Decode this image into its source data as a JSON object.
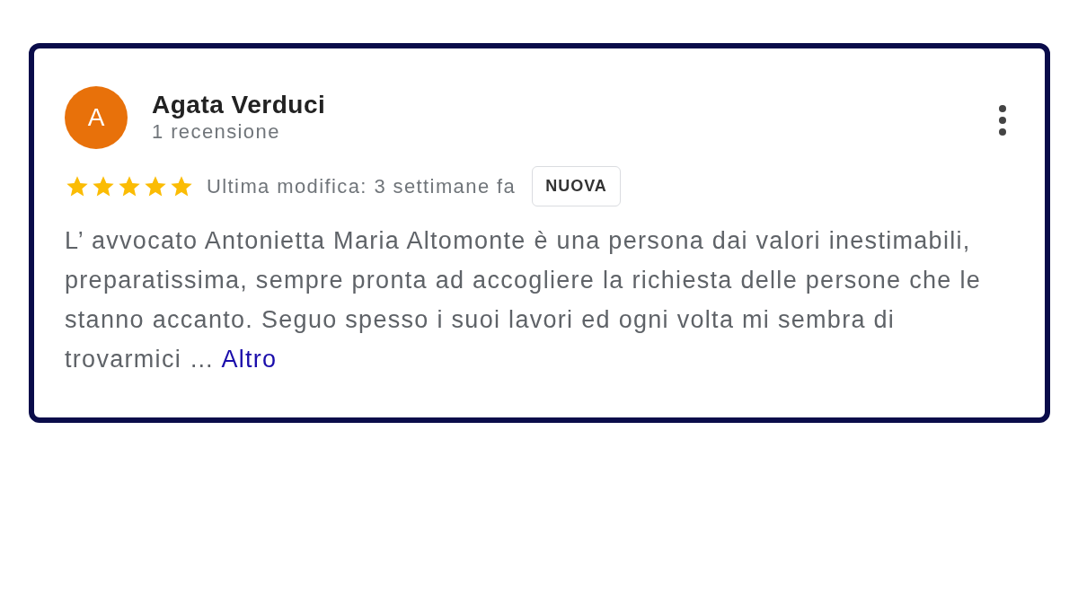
{
  "review": {
    "avatar_initial": "A",
    "name": "Agata Verduci",
    "review_count": "1 recensione",
    "stars": 5,
    "edited": "Ultima modifica: 3 settimane fa",
    "badge": "NUOVA",
    "text": "L’ avvocato Antonietta Maria Altomonte è una persona dai valori inestimabili, preparatissima, sempre pronta ad accogliere la richiesta delle persone che le stanno accanto. Seguo spesso i suoi lavori ed ogni volta mi sembra di trovarmici …",
    "more_link": "Altro"
  }
}
